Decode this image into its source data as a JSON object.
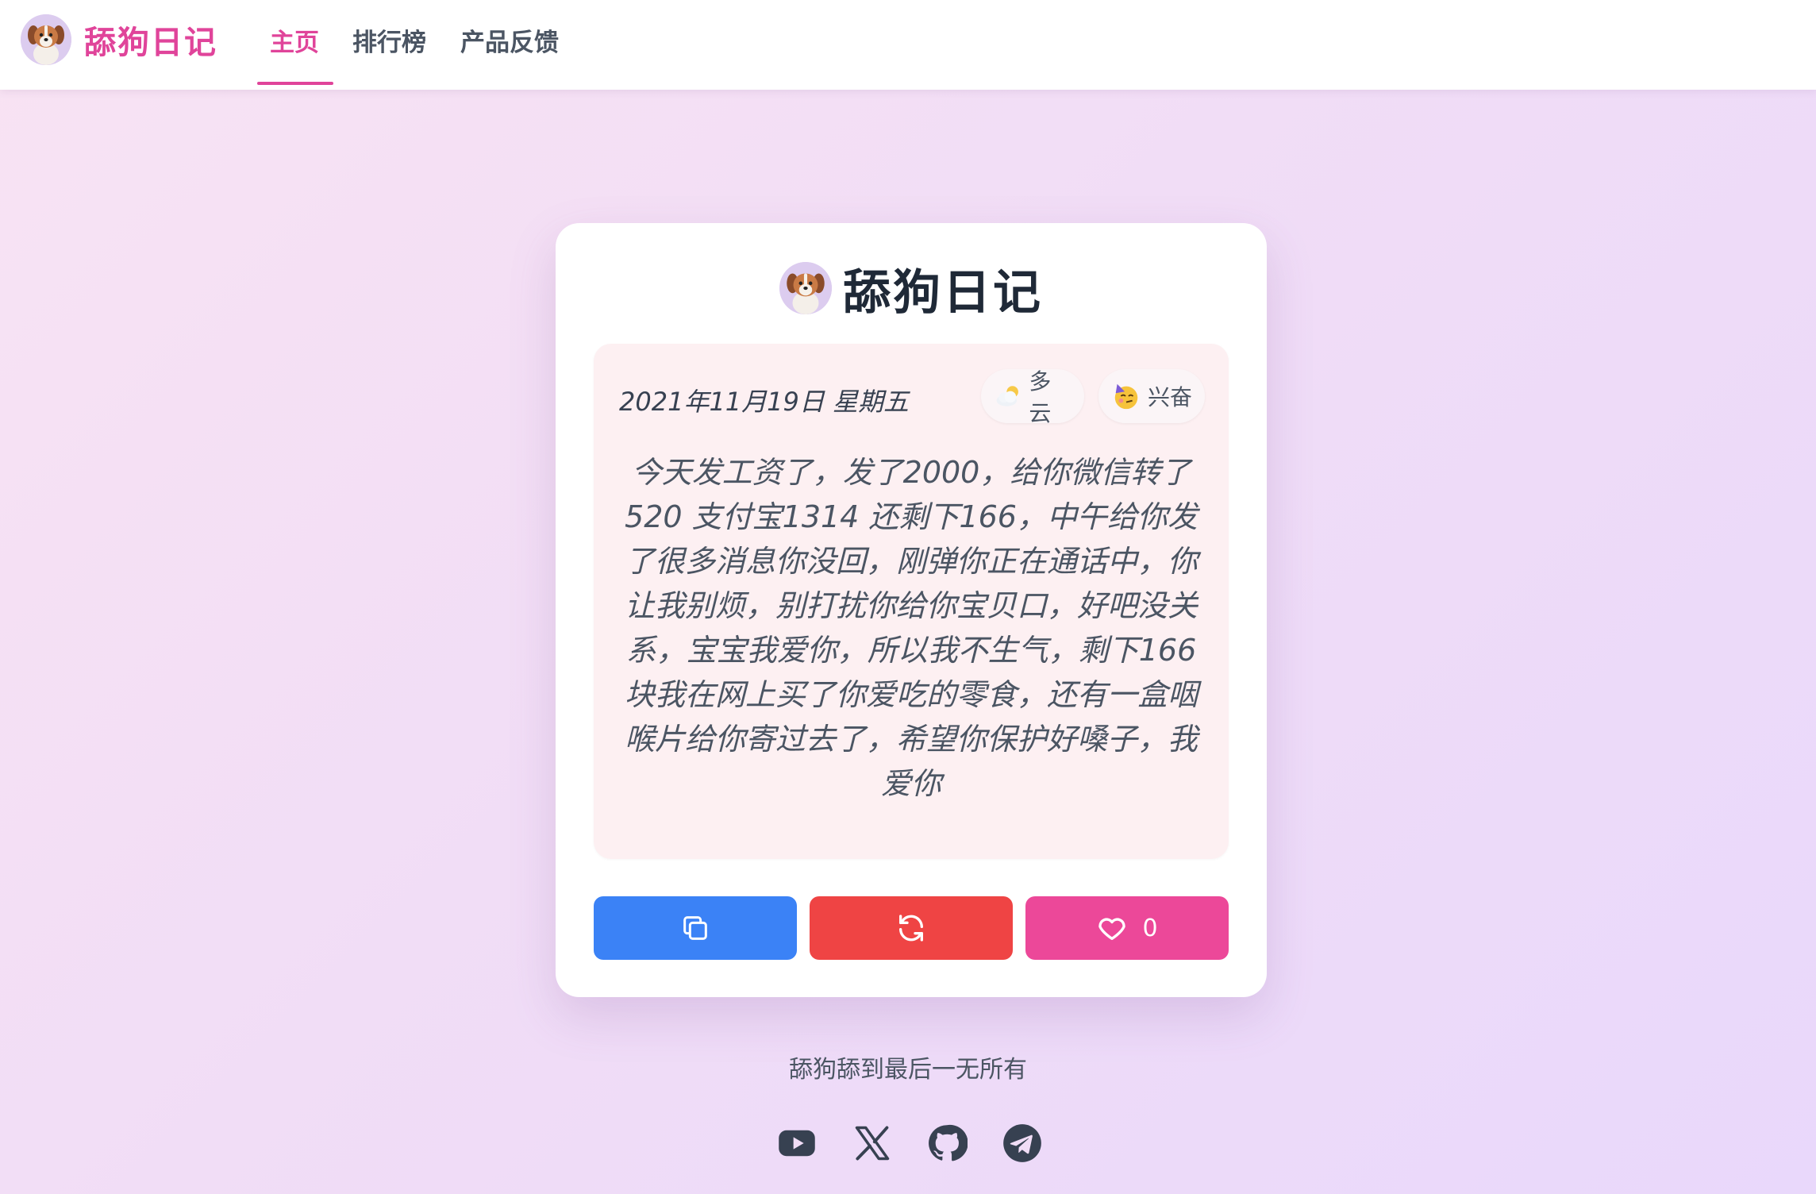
{
  "header": {
    "brand": "舔狗日记",
    "nav": [
      {
        "label": "主页",
        "active": true
      },
      {
        "label": "排行榜",
        "active": false
      },
      {
        "label": "产品反馈",
        "active": false
      }
    ]
  },
  "card": {
    "title": "舔狗日记",
    "date": "2021年11月19日 星期五",
    "weather": {
      "icon": "cloud-sun-icon",
      "label": "多云"
    },
    "mood": {
      "icon": "party-face-icon",
      "label": "兴奋"
    },
    "content": "今天发工资了，发了2000，给你微信转了520 支付宝1314 还剩下166，中午给你发了很多消息你没回，刚弹你正在通话中，你让我别烦，别打扰你给你宝贝口，好吧没关系，宝宝我爱你，所以我不生气，剩下166块我在网上买了你爱吃的零食，还有一盒咽喉片给你寄过去了，希望你保护好嗓子，我爱你",
    "buttons": {
      "copy": {
        "icon": "copy-icon",
        "color": "#3b82f6"
      },
      "refresh": {
        "icon": "refresh-icon",
        "color": "#ef4444"
      },
      "like": {
        "icon": "heart-icon",
        "count": "0",
        "color": "#ec4899"
      }
    }
  },
  "footer": {
    "slogan": "舔狗舔到最后一无所有",
    "socials": [
      "youtube-icon",
      "x-icon",
      "github-icon",
      "telegram-icon"
    ]
  },
  "colors": {
    "accent": "#e0449a",
    "card_bg": "#ffffff",
    "diary_bg": "#fdf0f2"
  }
}
